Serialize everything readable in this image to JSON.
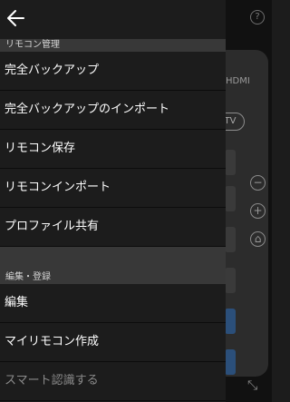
{
  "drawer": {
    "sections": [
      {
        "title": "リモコン管理",
        "items": [
          "完全バックアップ",
          "完全バックアップのインポート",
          "リモコン保存",
          "リモコンインポート",
          "プロファイル共有"
        ]
      },
      {
        "title": "編集・登録",
        "items": [
          "編集",
          "マイリモコン作成",
          "スマート認識する"
        ]
      }
    ]
  },
  "background": {
    "help_glyph": "?",
    "hdmi_label": "HDMI",
    "tv_label": "TV"
  },
  "icons": {
    "back": "arrow-left-icon",
    "help": "help-circle-icon",
    "minus": "minus-circle-icon",
    "plus": "plus-circle-icon",
    "home": "home-icon",
    "expand": "expand-icon"
  },
  "colors": {
    "drawer_bg": "#1c1c1c",
    "section_bg": "#383838",
    "text": "#ffffff"
  }
}
